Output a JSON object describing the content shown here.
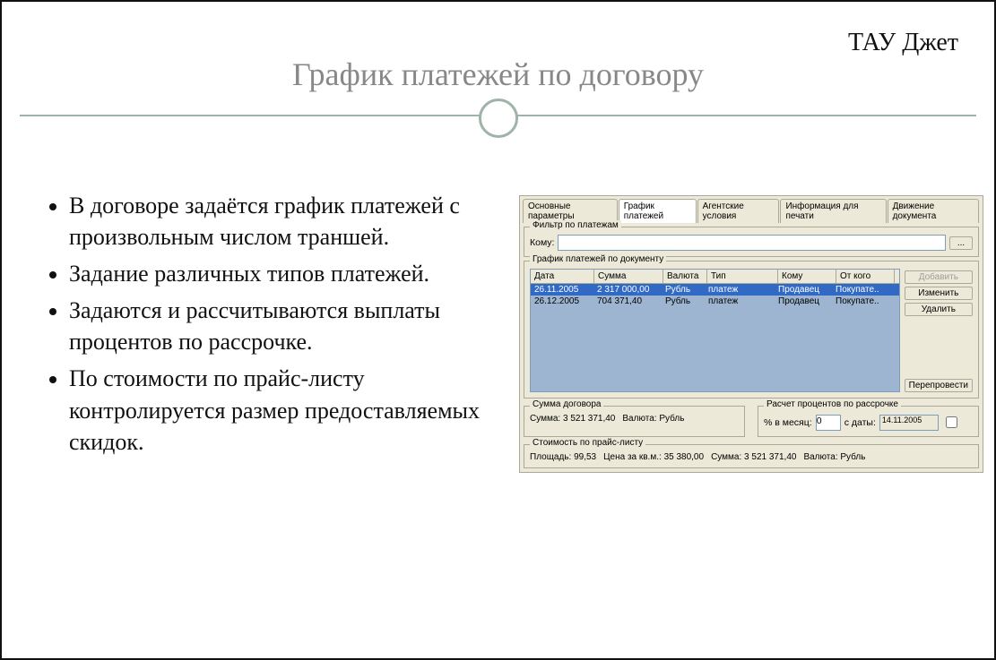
{
  "brand": "ТАУ Джет",
  "title": "График платежей по договору",
  "bullets": [
    "В договоре задаётся график платежей с произвольным числом траншей.",
    "Задание различных типов платежей.",
    "Задаются и рассчитываются выплаты процентов по рассрочке.",
    "По стоимости по прайс-листу контролируется размер предоставляемых скидок."
  ],
  "app": {
    "tabs": [
      "Основные параметры",
      "График платежей",
      "Агентские условия",
      "Информация для печати",
      "Движение документа"
    ],
    "filter": {
      "legend": "Фильтр по платежам",
      "to_label": "Кому:",
      "browse": "..."
    },
    "schedule": {
      "legend": "График платежей по документу",
      "cols": [
        "Дата",
        "Сумма",
        "Валюта",
        "Тип",
        "Кому",
        "От кого"
      ],
      "rows": [
        [
          "26.11.2005",
          "2 317 000,00",
          "Рубль",
          "платеж",
          "Продавец",
          "Покупате.."
        ],
        [
          "26.12.2005",
          "704 371,40",
          "Рубль",
          "платеж",
          "Продавец",
          "Покупате.."
        ]
      ]
    },
    "buttons": {
      "add": "Добавить",
      "edit": "Изменить",
      "del": "Удалить",
      "repost": "Перепровести"
    },
    "sum": {
      "legend": "Сумма договора",
      "sum_l": "Сумма:",
      "sum_v": "3 521 371,40",
      "cur_l": "Валюта:",
      "cur_v": "Рубль"
    },
    "pct": {
      "legend": "Расчет процентов по рассрочке",
      "pct_l": "% в месяц:",
      "pct_v": "0",
      "from_l": "с даты:",
      "from_v": "14.11.2005"
    },
    "price": {
      "legend": "Стоимость по прайс-листу",
      "area_l": "Площадь:",
      "area_v": "99,53",
      "psm_l": "Цена за кв.м.:",
      "psm_v": "35 380,00",
      "sum_l": "Сумма:",
      "sum_v": "3 521 371,40",
      "cur_l": "Валюта:",
      "cur_v": "Рубль"
    }
  }
}
